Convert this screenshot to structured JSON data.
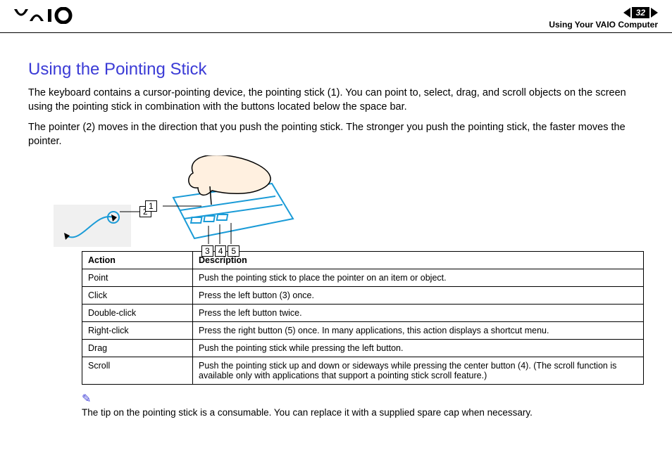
{
  "header": {
    "page_number": "32",
    "section_label": "Using Your VAIO Computer"
  },
  "title": "Using the Pointing Stick",
  "paragraphs": {
    "p1": "The keyboard contains a cursor-pointing device, the pointing stick (1). You can point to, select, drag, and scroll objects on the screen using the pointing stick in combination with the buttons located below the space bar.",
    "p2": "The pointer (2) moves in the direction that you push the pointing stick. The stronger you push the pointing stick, the faster moves the pointer."
  },
  "illus": {
    "c1": "1",
    "c2": "2",
    "c3": "3",
    "c4": "4",
    "c5": "5"
  },
  "table": {
    "head_action": "Action",
    "head_desc": "Description",
    "rows": [
      {
        "action": "Point",
        "desc": "Push the pointing stick to place the pointer on an item or object."
      },
      {
        "action": "Click",
        "desc": "Press the left button (3) once."
      },
      {
        "action": "Double-click",
        "desc": "Press the left button twice."
      },
      {
        "action": "Right-click",
        "desc": "Press the right button (5) once. In many applications, this action displays a shortcut menu."
      },
      {
        "action": "Drag",
        "desc": "Push the pointing stick while pressing the left button."
      },
      {
        "action": "Scroll",
        "desc": "Push the pointing stick up and down or sideways while pressing the center button (4). (The scroll function is available only with applications that support a pointing stick scroll feature.)"
      }
    ]
  },
  "note": {
    "icon": "✎",
    "text": "The tip on the pointing stick is a consumable. You can replace it with a supplied spare cap when necessary."
  }
}
